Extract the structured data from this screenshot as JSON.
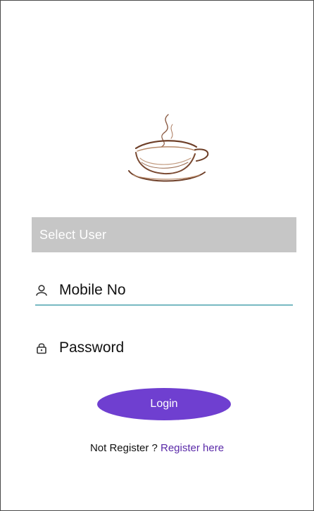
{
  "logo": {
    "icon": "coffee-cup-icon",
    "colors": {
      "cup": "#7a4a32",
      "accent": "#b88a6a"
    }
  },
  "select_user": {
    "value": "Select User",
    "background": "#c6c6c6"
  },
  "mobile_field": {
    "icon": "user-icon",
    "label": "Mobile No",
    "underline_color": "#78b9c2"
  },
  "password_field": {
    "icon": "lock-icon",
    "label": "Password"
  },
  "login_button": {
    "label": "Login",
    "color": "#6f3fd0"
  },
  "register": {
    "prompt": "Not Register ? ",
    "link": "Register here",
    "link_color": "#5a2aa8"
  }
}
